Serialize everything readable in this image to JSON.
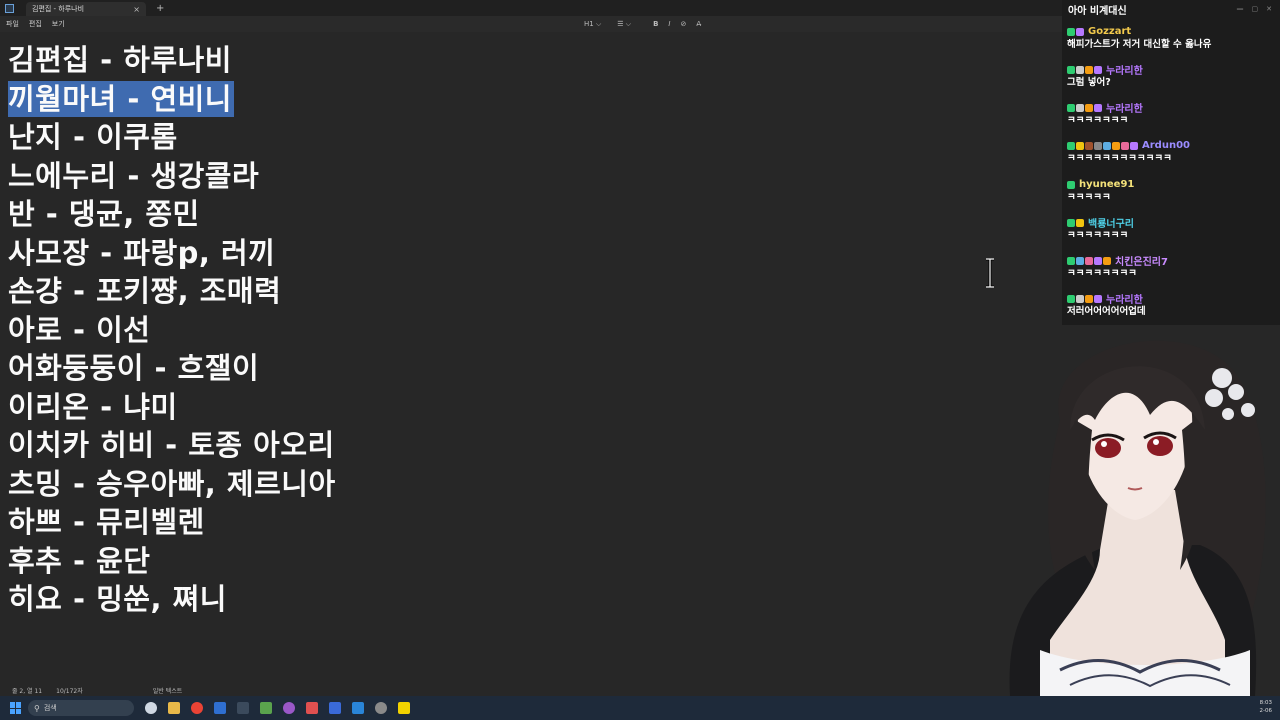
{
  "window": {
    "tab_title": "김편집 - 하루나비",
    "tab_close": "×",
    "new_tab": "+",
    "menu": [
      "파일",
      "편집",
      "보기"
    ],
    "toolbar": {
      "heading": "H1 ⌵",
      "list": "☰ ⌵",
      "bold": "B",
      "italic": "I",
      "link": "⊘",
      "clear": "A̶"
    }
  },
  "editor": {
    "lines": [
      "김편집 - 하루나비",
      "끼월마녀 - 연비니",
      "난지 - 이쿠롬",
      "느에누리 - 생강콜라",
      "반 - 댕균, 쫑민",
      "사모장 - 파랑p, 러끼",
      "손걍 - 포키쨩, 조매력",
      "아로 - 이선",
      "어화둥둥이 - 흐잴이",
      "이리온 - 냐미",
      "이치카 히비 - 토종 아오리",
      "츠밍 - 승우아빠, 제르니아",
      "하쁘 - 뮤리벨렌",
      "후추 - 윤단",
      "히요 - 밍쑨, 쪄니"
    ],
    "selected_line_index": 1
  },
  "status": {
    "position": "줄 2, 열 11",
    "chars": "10/172자",
    "format": "일반 텍스트"
  },
  "chat": {
    "title": "아아 비계대신",
    "messages": [
      {
        "name": "Gozzart",
        "color": "#f2c94c",
        "text": "해피가스트가 저거 대신할 수 옳나유"
      },
      {
        "name": "누라리한",
        "color": "#b678ff",
        "text": "그럼 넣어?"
      },
      {
        "name": "누라리한",
        "color": "#b678ff",
        "text": "ㅋㅋㅋㅋㅋㅋㅋ"
      },
      {
        "name": "Ardun00",
        "color": "#9b8cff",
        "text": "ㅋㅋㅋㅋㅋㅋㅋㅋㅋㅋㅋㅋ"
      },
      {
        "name": "hyunee91",
        "color": "#f4e27a",
        "text": "ㅋㅋㅋㅋㅋ"
      },
      {
        "name": "백룡너구리",
        "color": "#4fd1e8",
        "text": "ㅋㅋㅋㅋㅋㅋㅋ"
      },
      {
        "name": "치킨은진리7",
        "color": "#c98bff",
        "text": "ㅋㅋㅋㅋㅋㅋㅋㅋ"
      },
      {
        "name": "누라리한",
        "color": "#b678ff",
        "text": "저러어어어어어업데"
      }
    ]
  },
  "taskbar": {
    "search_placeholder": "검색",
    "time": "8:03",
    "date": "2-06"
  },
  "colors": {
    "selection": "#3f6bb0",
    "editor_bg": "#272727",
    "taskbar_bg": "#1e2a3a"
  }
}
